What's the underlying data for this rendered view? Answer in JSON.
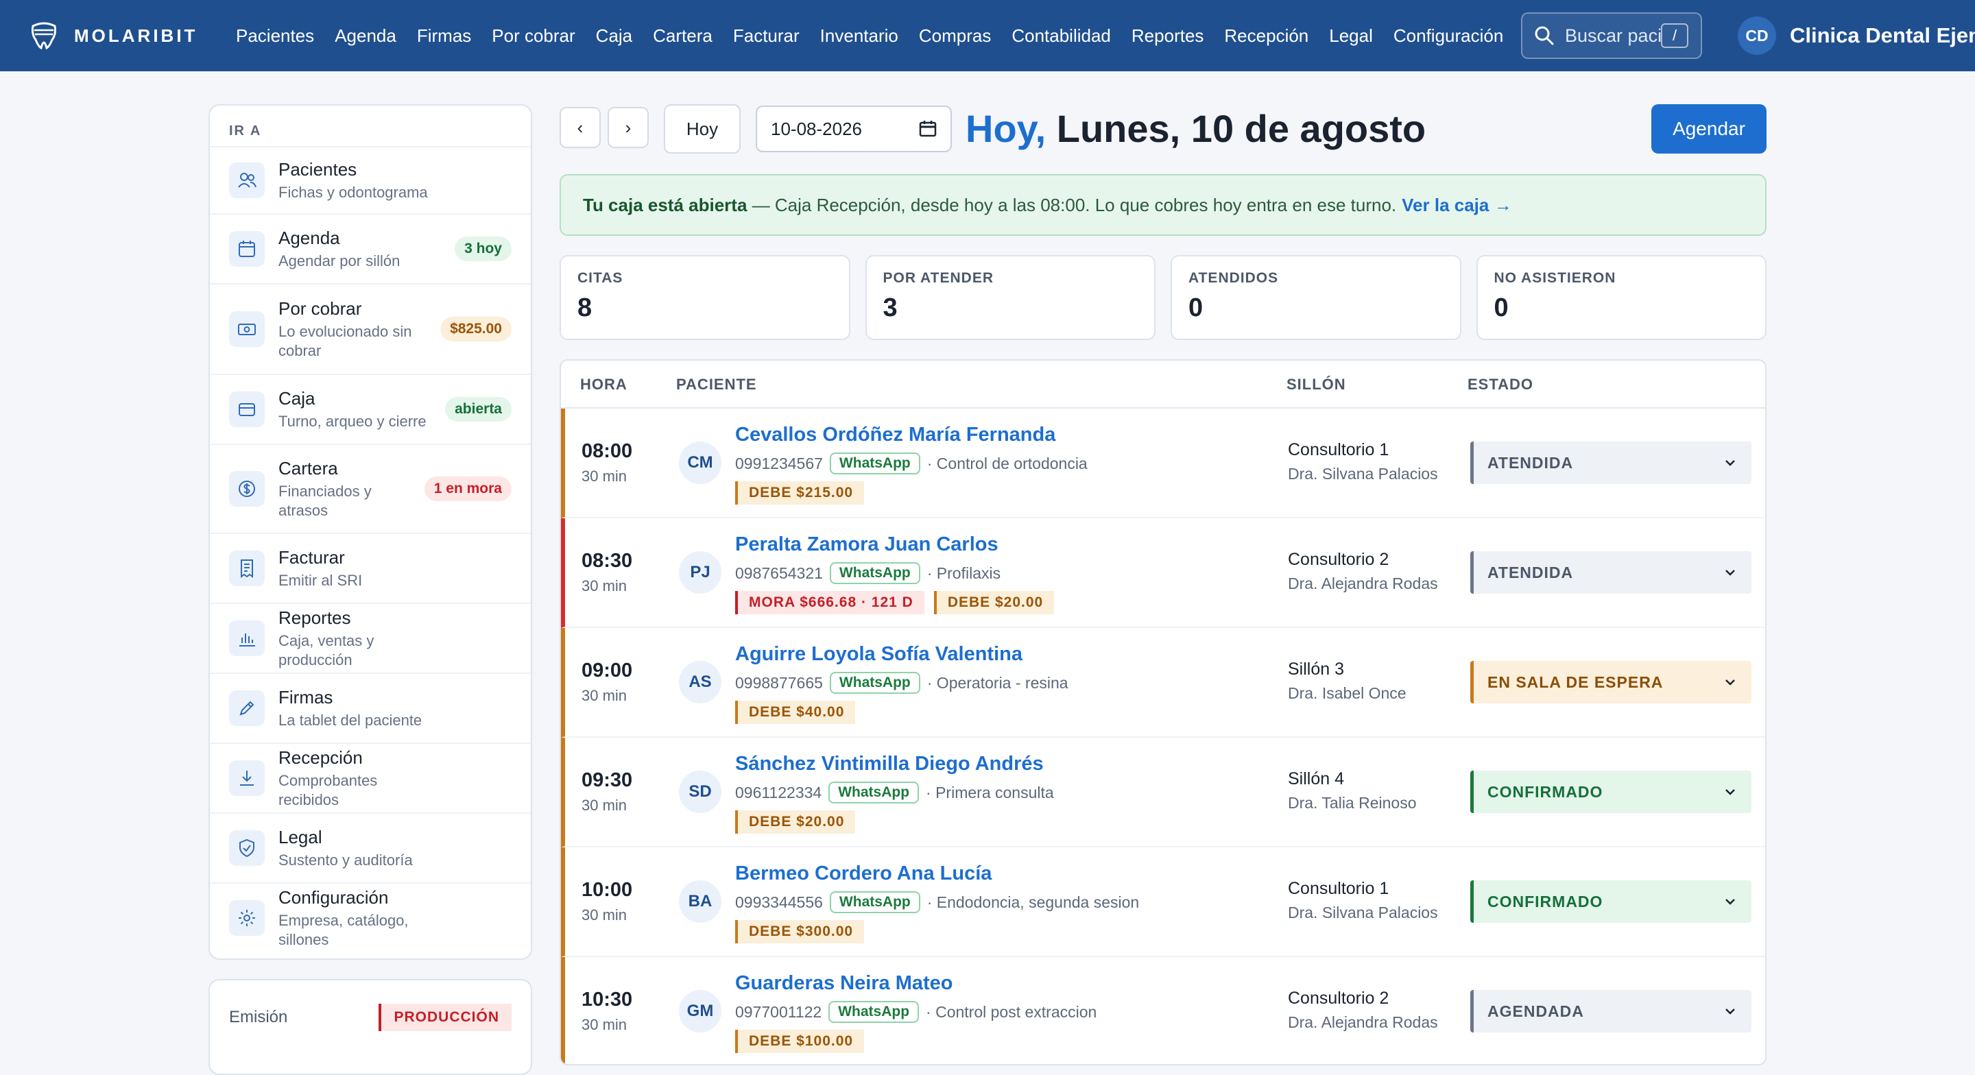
{
  "brand": {
    "name": "MOLARIBIT"
  },
  "nav": [
    "Pacientes",
    "Agenda",
    "Firmas",
    "Por cobrar",
    "Caja",
    "Cartera",
    "Facturar",
    "Inventario",
    "Compras",
    "Contabilidad",
    "Reportes",
    "Recepción",
    "Legal",
    "Configuración"
  ],
  "search": {
    "placeholder": "Buscar paci",
    "shortcut": "/"
  },
  "user": {
    "initials": "CD",
    "clinic": "Clinica Dental Ejemp"
  },
  "sidebar": {
    "heading": "IR A",
    "items": [
      {
        "title": "Pacientes",
        "sub": "Fichas y odontograma",
        "badge": "",
        "icon": "users-icon"
      },
      {
        "title": "Agenda",
        "sub": "Agendar por sillón",
        "badge": "3 hoy",
        "icon": "calendar-icon"
      },
      {
        "title": "Por cobrar",
        "sub": "Lo evolucionado sin cobrar",
        "badge": "$825.00",
        "icon": "cash-icon"
      },
      {
        "title": "Caja",
        "sub": "Turno, arqueo y cierre",
        "badge": "abierta",
        "icon": "cash-register-icon"
      },
      {
        "title": "Cartera",
        "sub": "Financiados y atrasos",
        "badge": "1 en mora",
        "icon": "dollar-icon"
      },
      {
        "title": "Facturar",
        "sub": "Emitir al SRI",
        "badge": "",
        "icon": "invoice-icon"
      },
      {
        "title": "Reportes",
        "sub": "Caja, ventas y producción",
        "badge": "",
        "icon": "bar-chart-icon"
      },
      {
        "title": "Firmas",
        "sub": "La tablet del paciente",
        "badge": "",
        "icon": "pen-icon"
      },
      {
        "title": "Recepción",
        "sub": "Comprobantes recibidos",
        "badge": "",
        "icon": "download-icon"
      },
      {
        "title": "Legal",
        "sub": "Sustento y auditoría",
        "badge": "",
        "icon": "shield-icon"
      },
      {
        "title": "Configuración",
        "sub": "Empresa, catálogo, sillones",
        "badge": "",
        "icon": "gear-icon"
      }
    ]
  },
  "emision": {
    "label": "Emisión",
    "value": "PRODUCCIÓN"
  },
  "toolbar": {
    "prev": "‹",
    "next": "›",
    "today": "Hoy",
    "date": "10-08-2026",
    "title_accent": "Hoy,",
    "title_rest": "Lunes, 10 de agosto",
    "schedule": "Agendar"
  },
  "banner": {
    "bold": "Tu caja está abierta",
    "text": " — Caja Recepción, desde hoy a las 08:00. Lo que cobres hoy entra en ese turno.",
    "link": "Ver la caja →"
  },
  "stats": [
    {
      "label": "CITAS",
      "value": "8"
    },
    {
      "label": "POR ATENDER",
      "value": "3"
    },
    {
      "label": "ATENDIDOS",
      "value": "0"
    },
    {
      "label": "NO ASISTIERON",
      "value": "0"
    }
  ],
  "table": {
    "headers": {
      "hora": "HORA",
      "paciente": "PACIENTE",
      "sillon": "SILLÓN",
      "estado": "ESTADO"
    },
    "rows": [
      {
        "hora": "08:00",
        "dur": "30 min",
        "initials": "CM",
        "name": "Cevallos Ordóñez María Fernanda",
        "phone": "0991234567",
        "wa": "WhatsApp",
        "reason": "· Control de ortodoncia",
        "mora": "",
        "debe": "DEBE $215.00",
        "sillon": "Consultorio 1",
        "doctor": "Dra. Silvana Palacios",
        "estado": "ATENDIDA",
        "estado_color": "gray"
      },
      {
        "hora": "08:30",
        "dur": "30 min",
        "initials": "PJ",
        "name": "Peralta Zamora Juan Carlos",
        "phone": "0987654321",
        "wa": "WhatsApp",
        "reason": "· Profilaxis",
        "mora": "MORA $666.68 · 121 D",
        "debe": "DEBE $20.00",
        "sillon": "Consultorio 2",
        "doctor": "Dra. Alejandra Rodas",
        "estado": "ATENDIDA",
        "estado_color": "gray"
      },
      {
        "hora": "09:00",
        "dur": "30 min",
        "initials": "AS",
        "name": "Aguirre Loyola Sofía Valentina",
        "phone": "0998877665",
        "wa": "WhatsApp",
        "reason": "· Operatoria - resina",
        "mora": "",
        "debe": "DEBE $40.00",
        "sillon": "Sillón 3",
        "doctor": "Dra. Isabel Once",
        "estado": "EN SALA DE ESPERA",
        "estado_color": "orange"
      },
      {
        "hora": "09:30",
        "dur": "30 min",
        "initials": "SD",
        "name": "Sánchez Vintimilla Diego Andrés",
        "phone": "0961122334",
        "wa": "WhatsApp",
        "reason": "· Primera consulta",
        "mora": "",
        "debe": "DEBE $20.00",
        "sillon": "Sillón 4",
        "doctor": "Dra. Talia Reinoso",
        "estado": "CONFIRMADO",
        "estado_color": "green"
      },
      {
        "hora": "10:00",
        "dur": "30 min",
        "initials": "BA",
        "name": "Bermeo Cordero Ana Lucía",
        "phone": "0993344556",
        "wa": "WhatsApp",
        "reason": "· Endodoncia, segunda sesion",
        "mora": "",
        "debe": "DEBE $300.00",
        "sillon": "Consultorio 1",
        "doctor": "Dra. Silvana Palacios",
        "estado": "CONFIRMADO",
        "estado_color": "green"
      },
      {
        "hora": "10:30",
        "dur": "30 min",
        "initials": "GM",
        "name": "Guarderas Neira Mateo",
        "phone": "0977001122",
        "wa": "WhatsApp",
        "reason": "· Control post extraccion",
        "mora": "",
        "debe": "DEBE $100.00",
        "sillon": "Consultorio 2",
        "doctor": "Dra. Alejandra Rodas",
        "estado": "AGENDADA",
        "estado_color": "gray"
      }
    ]
  }
}
